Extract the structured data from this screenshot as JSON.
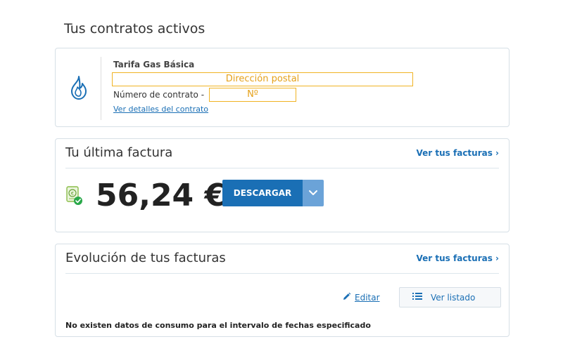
{
  "page": {
    "title": "Tus contratos activos"
  },
  "contract": {
    "icon": "flame-icon",
    "tariff_name": "Tarifa Gas Básica",
    "postal_address_placeholder": "Dirección postal",
    "contract_number_label": "Número de contrato -",
    "contract_number_placeholder": "Nº",
    "details_link": "Ver detalles del contrato"
  },
  "last_invoice": {
    "title": "Tu última factura",
    "view_invoices_link": "Ver tus facturas ›",
    "icon": "invoice-euro-check-icon",
    "amount": "56,24 €",
    "download_label": "DESCARGAR",
    "download_toggle_icon": "chevron-down-icon"
  },
  "evolution": {
    "title": "Evolución de tus facturas",
    "view_invoices_link": "Ver tus facturas ›",
    "edit_label": "Editar",
    "edit_icon": "pencil-icon",
    "list_label": "Ver listado",
    "list_icon": "list-icon",
    "no_data_message": "No existen datos de consumo para el intervalo de fechas especificado"
  },
  "colors": {
    "primary": "#1a6fb5",
    "primary_light": "#6ba3d8",
    "placeholder_border": "#f0b323",
    "success": "#2aa84a",
    "border": "#d6dfe6"
  }
}
